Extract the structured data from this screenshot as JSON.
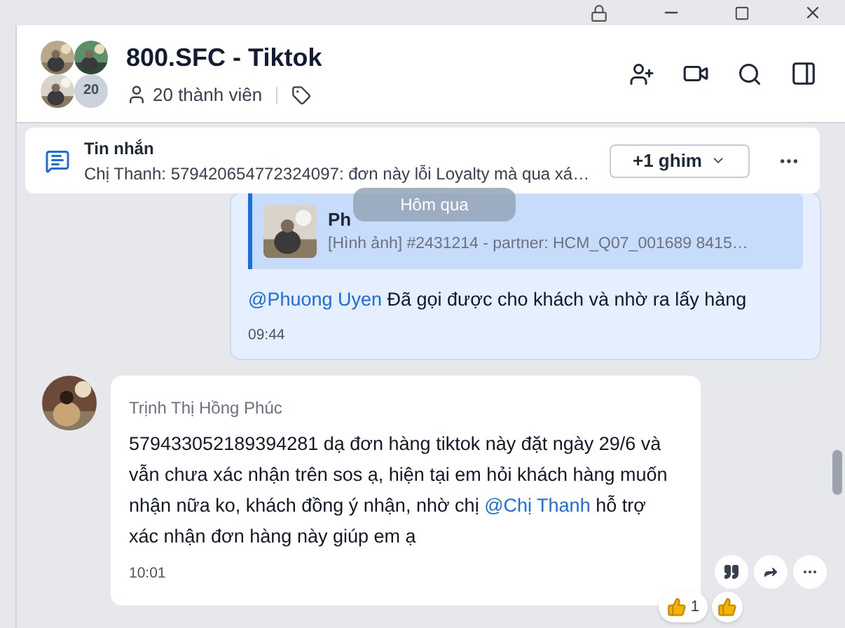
{
  "header": {
    "title": "800.SFC - Tiktok",
    "member_count_badge": "20",
    "members": "20 thành viên"
  },
  "pinned": {
    "title": "Tin nhắn",
    "preview": "Chị Thanh: 579420654772324097: đơn này lỗi Loyalty mà qua xá…",
    "pin_button": "+1 ghim"
  },
  "date_divider": "Hôm qua",
  "messages": [
    {
      "kind": "sent",
      "quote": {
        "sender": "Ph",
        "text": "[Hình ảnh] #2431214 - partner: HCM_Q07_001689 8415…"
      },
      "parts": [
        {
          "kind": "mention",
          "text": "@Phuong Uyen"
        },
        {
          "kind": "text",
          "text": " Đã gọi được cho khách và nhờ ra lấy hàng"
        }
      ],
      "time": "09:44"
    },
    {
      "kind": "received",
      "sender": "Trịnh Thị Hồng Phúc",
      "parts": [
        {
          "kind": "text",
          "text": "579433052189394281 dạ đơn hàng tiktok này đặt ngày 29/6 và vẫn chưa xác nhận trên sos ạ, hiện tại em hỏi khách hàng muốn nhận nữa ko, khách đồng ý nhận, nhờ chị "
        },
        {
          "kind": "mention",
          "text": "@Chị Thanh"
        },
        {
          "kind": "text",
          "text": " hỗ trợ xác nhận đơn hàng này giúp em ạ"
        }
      ],
      "time": "10:01",
      "reaction_count": "1"
    }
  ]
}
